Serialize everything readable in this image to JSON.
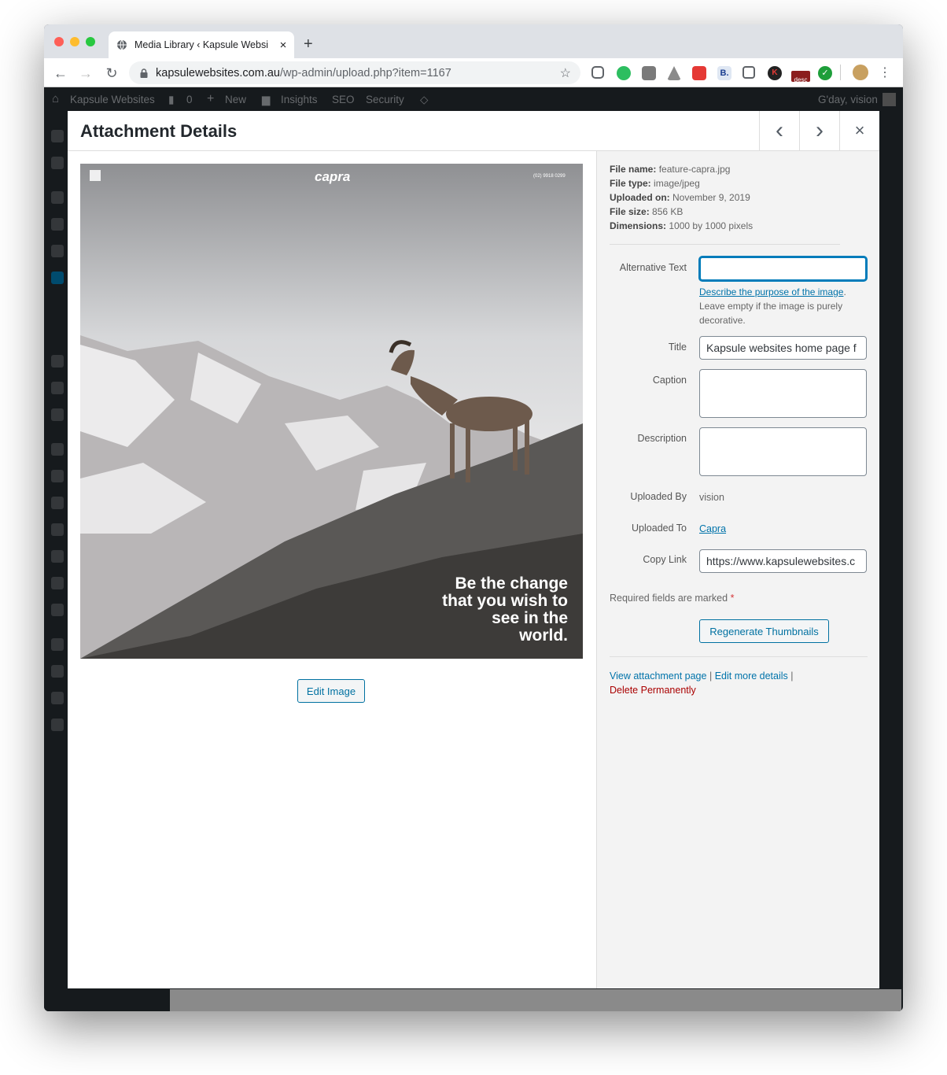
{
  "browser": {
    "tab_title": "Media Library ‹ Kapsule Websi",
    "tab_close": "×",
    "new_tab": "+",
    "url_host": "kapsulewebsites.com.au",
    "url_path": "/wp-admin/upload.php?item=1167",
    "ext_badge": "desc"
  },
  "adminbar": {
    "site_name": "Kapsule Websites",
    "comments_count": "0",
    "new_label": "New",
    "insights_label": "Insights",
    "seo_label": "SEO",
    "security_label": "Security",
    "greeting": "G'day, vision"
  },
  "modal": {
    "title": "Attachment Details",
    "prev_icon": "‹",
    "next_icon": "›",
    "close_icon": "×",
    "edit_image_label": "Edit Image"
  },
  "photo": {
    "brand": "capra",
    "phone": "(02) 9918 0299",
    "tagline": [
      "Be the change",
      "that you wish to",
      "see in the",
      "world."
    ]
  },
  "file_info": {
    "name_label": "File name:",
    "name": "feature-capra.jpg",
    "type_label": "File type:",
    "type": "image/jpeg",
    "uploaded_label": "Uploaded on:",
    "uploaded": "November 9, 2019",
    "size_label": "File size:",
    "size": "856 KB",
    "dims_label": "Dimensions:",
    "dims": "1000 by 1000 pixels"
  },
  "form": {
    "alt_label": "Alternative Text",
    "alt_value": "",
    "alt_help_link": "Describe the purpose of the image",
    "alt_help_text": "Leave empty if the image is purely decorative.",
    "title_label": "Title",
    "title_value": "Kapsule websites home page f",
    "caption_label": "Caption",
    "caption_value": "",
    "description_label": "Description",
    "description_value": "",
    "uploaded_by_label": "Uploaded By",
    "uploaded_by": "vision",
    "uploaded_to_label": "Uploaded To",
    "uploaded_to": "Capra",
    "copy_link_label": "Copy Link",
    "copy_link_value": "https://www.kapsulewebsites.c",
    "required_text": "Required fields are marked",
    "required_star": "*",
    "regenerate_label": "Regenerate Thumbnails"
  },
  "actions": {
    "view_page": "View attachment page",
    "edit_more": "Edit more details",
    "delete": "Delete Permanently",
    "sep": "|"
  },
  "colors": {
    "link": "#0073aa",
    "delete": "#aa0000",
    "adminbar": "#23282d"
  }
}
